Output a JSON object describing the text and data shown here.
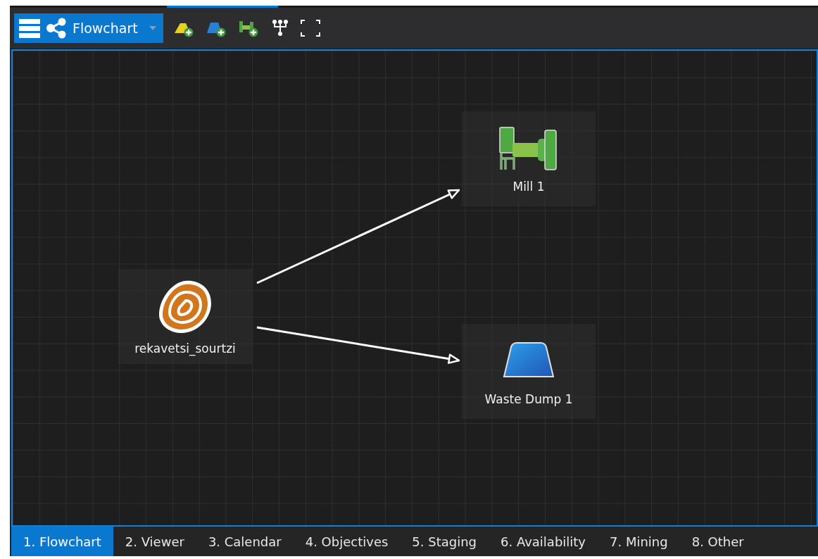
{
  "toolbar": {
    "view_selector": {
      "label": "Flowchart"
    }
  },
  "flowchart": {
    "source": {
      "label": "rekavetsi_sourtzi",
      "kind": "ore-source",
      "outputs": [
        {
          "label": "Mill 1",
          "kind": "mill"
        },
        {
          "label": "Waste Dump 1",
          "kind": "dump"
        }
      ]
    }
  },
  "tabs": [
    {
      "label": "1. Flowchart",
      "selected": true
    },
    {
      "label": "2. Viewer",
      "selected": false
    },
    {
      "label": "3. Calendar",
      "selected": false
    },
    {
      "label": "4. Objectives",
      "selected": false
    },
    {
      "label": "5. Staging",
      "selected": false
    },
    {
      "label": "6. Availability",
      "selected": false
    },
    {
      "label": "7. Mining",
      "selected": false
    },
    {
      "label": "8. Other",
      "selected": false
    }
  ]
}
